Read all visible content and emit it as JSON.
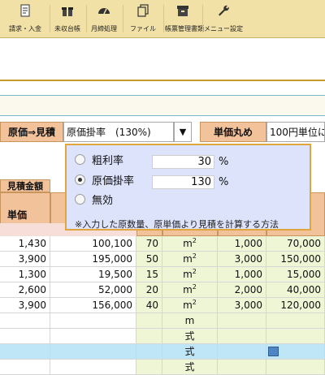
{
  "toolbar": {
    "buttons": [
      {
        "label": "請求・入金",
        "icon": "document-icon"
      },
      {
        "label": "未収台帳",
        "icon": "gift-icon"
      },
      {
        "label": "月締処理",
        "icon": "dashboard-icon"
      },
      {
        "label": "ファイル",
        "icon": "copy-icon"
      },
      {
        "label": "帳票管理書類",
        "icon": "archive-icon"
      },
      {
        "label": "メニュー設定",
        "icon": "wrench-icon"
      }
    ]
  },
  "controls": {
    "conversion_label": "原価⇒見積",
    "conversion_selected": "原価掛率　(130%)",
    "rounding_label": "単価丸め",
    "rounding_value": "100円単位に"
  },
  "popup": {
    "options": [
      {
        "label": "粗利率",
        "value": "30",
        "unit": "%",
        "selected": false
      },
      {
        "label": "原価掛率",
        "value": "130",
        "unit": "%",
        "selected": true
      },
      {
        "label": "無効",
        "selected": false
      }
    ],
    "note": "※入力した原数量、原単価より見積を計算する方法"
  },
  "table": {
    "group_header": "見積金額",
    "col_unit_price": "単価",
    "rows": [
      {
        "price": "1,430",
        "amount": "100,100",
        "qty": "70",
        "unit": "m",
        "sup": "2",
        "cost_price": "1,000",
        "cost_amount": "70,000"
      },
      {
        "price": "3,900",
        "amount": "195,000",
        "qty": "50",
        "unit": "m",
        "sup": "2",
        "cost_price": "3,000",
        "cost_amount": "150,000"
      },
      {
        "price": "1,300",
        "amount": "19,500",
        "qty": "15",
        "unit": "m",
        "sup": "2",
        "cost_price": "1,000",
        "cost_amount": "15,000"
      },
      {
        "price": "2,600",
        "amount": "52,000",
        "qty": "20",
        "unit": "m",
        "sup": "2",
        "cost_price": "2,000",
        "cost_amount": "40,000"
      },
      {
        "price": "3,900",
        "amount": "156,000",
        "qty": "40",
        "unit": "m",
        "sup": "2",
        "cost_price": "3,000",
        "cost_amount": "120,000"
      },
      {
        "price": "",
        "amount": "",
        "qty": "",
        "unit": "m",
        "sup": "",
        "cost_price": "",
        "cost_amount": ""
      },
      {
        "price": "",
        "amount": "",
        "qty": "",
        "unit": "式",
        "sup": "",
        "cost_price": "",
        "cost_amount": ""
      },
      {
        "price": "",
        "amount": "",
        "qty": "",
        "unit": "式",
        "sup": "",
        "cost_price": "",
        "cost_amount": ""
      },
      {
        "price": "",
        "amount": "",
        "qty": "",
        "unit": "式",
        "sup": "",
        "cost_price": "",
        "cost_amount": ""
      }
    ]
  },
  "colors": {
    "toolbar": "#f2e1a6",
    "header": "#f2c29b",
    "popup_border": "#e1a53d",
    "selected_row": "#bfe6f7"
  }
}
